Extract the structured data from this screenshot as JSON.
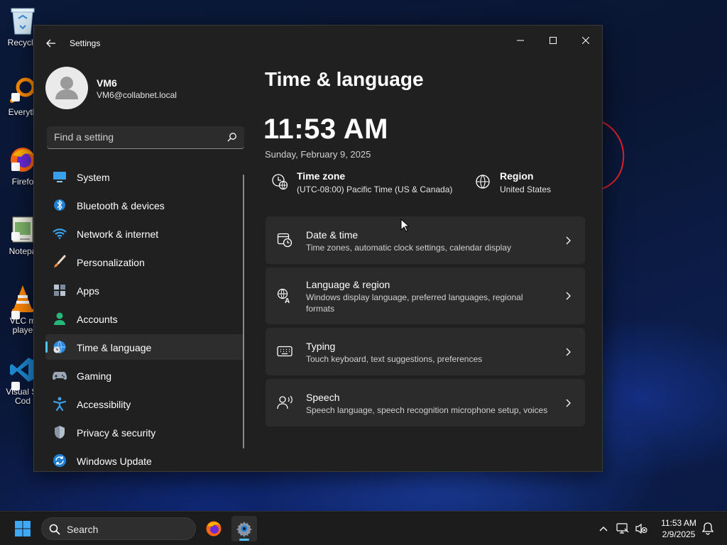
{
  "desktop": {
    "icons": [
      {
        "name": "recycle-bin",
        "label": "Recycle"
      },
      {
        "name": "everything",
        "label": "Everyth"
      },
      {
        "name": "firefox",
        "label": "Firefo"
      },
      {
        "name": "notepad",
        "label": "Notepa"
      },
      {
        "name": "vlc",
        "label": "VLC m\nplaye"
      },
      {
        "name": "vscode",
        "label": "Visual St\nCod"
      }
    ]
  },
  "window": {
    "title": "Settings",
    "user": {
      "name": "VM6",
      "email": "VM6@collabnet.local"
    },
    "search": {
      "placeholder": "Find a setting"
    },
    "nav": [
      {
        "label": "System",
        "icon": "monitor-icon"
      },
      {
        "label": "Bluetooth & devices",
        "icon": "bluetooth-icon"
      },
      {
        "label": "Network & internet",
        "icon": "wifi-icon"
      },
      {
        "label": "Personalization",
        "icon": "brush-icon"
      },
      {
        "label": "Apps",
        "icon": "apps-icon"
      },
      {
        "label": "Accounts",
        "icon": "person-icon"
      },
      {
        "label": "Time & language",
        "icon": "globe-clock-icon",
        "active": true
      },
      {
        "label": "Gaming",
        "icon": "gamepad-icon"
      },
      {
        "label": "Accessibility",
        "icon": "accessibility-icon"
      },
      {
        "label": "Privacy & security",
        "icon": "shield-icon"
      },
      {
        "label": "Windows Update",
        "icon": "update-icon"
      }
    ],
    "page": {
      "title": "Time & language",
      "time": "11:53 AM",
      "date": "Sunday, February 9, 2025",
      "timezone": {
        "title": "Time zone",
        "value": "(UTC-08:00) Pacific Time (US & Canada)"
      },
      "region": {
        "title": "Region",
        "value": "United States"
      },
      "cards": [
        {
          "title": "Date & time",
          "desc": "Time zones, automatic clock settings, calendar display"
        },
        {
          "title": "Language & region",
          "desc": "Windows display language, preferred languages, regional formats"
        },
        {
          "title": "Typing",
          "desc": "Touch keyboard, text suggestions, preferences"
        },
        {
          "title": "Speech",
          "desc": "Speech language, speech recognition microphone setup, voices"
        }
      ]
    }
  },
  "taskbar": {
    "search_label": "Search",
    "clock_time": "11:53 AM",
    "clock_date": "2/9/2025"
  },
  "colors": {
    "accent": "#4cc2ff",
    "window_bg": "#202020",
    "card_bg": "#2b2b2b"
  }
}
